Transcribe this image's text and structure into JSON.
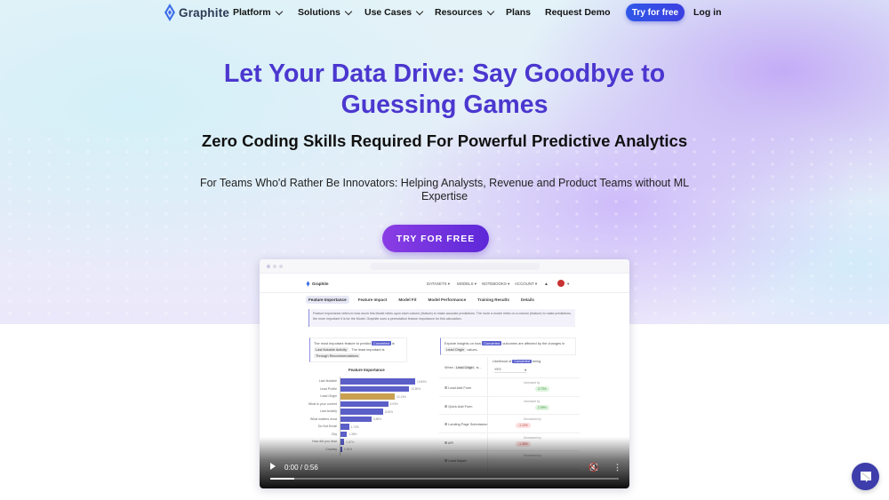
{
  "nav": {
    "brand": "Graphite",
    "items": [
      {
        "label": "Platform",
        "has_dropdown": true
      },
      {
        "label": "Solutions",
        "has_dropdown": true
      },
      {
        "label": "Use Cases",
        "has_dropdown": true
      },
      {
        "label": "Resources",
        "has_dropdown": true
      },
      {
        "label": "Plans",
        "has_dropdown": false
      },
      {
        "label": "Request Demo",
        "has_dropdown": false
      }
    ],
    "try_label": "Try for free",
    "login_label": "Log in"
  },
  "hero": {
    "title_line1": "Let Your Data Drive: Say Goodbye to",
    "title_line2": "Guessing Games",
    "subtitle": "Zero Coding Skills Required For Powerful Predictive Analytics",
    "tagline": "For Teams Who'd Rather Be Innovators:  Helping Analysts, Revenue and Product Teams without ML Expertise",
    "cta_label": "TRY FOR FREE"
  },
  "colors": {
    "accent": "#4b37cf",
    "cta_start": "#8a3de4",
    "cta_end": "#5d28d8",
    "nav_button": "#2f58e8",
    "chat": "#3d3dab"
  },
  "video": {
    "app": {
      "brand": "Graphite",
      "menu": [
        "DATASETS ▾",
        "MODELS ▾",
        "NOTEBOOKS ▾",
        "ACCOUNT ▾"
      ],
      "tabs": [
        "Feature Importance",
        "Feature Impact",
        "Model Fit",
        "Model Performance",
        "Training Results",
        "Details"
      ],
      "active_tab": "Feature Importance",
      "info_text": "Feature Importance refers to how much this Model relies upon each column (feature) to make accurate predictions. The more a model relies on a column (feature) to make predictions, the more important it is for the Model. Graphite uses a permutation feature importance for this calculation.",
      "left_card": {
        "pre": "The most important feature to predict",
        "target": "Converted",
        "mid": "is",
        "feature": "Last Notable Activity",
        "post": ". The least important is",
        "least": "Through Recommendations",
        "end": "."
      },
      "chart_title": "Feature Importance",
      "features": [
        {
          "label": "Last Notable",
          "value": "13.89%",
          "pct": 13.89
        },
        {
          "label": "Lead Profile",
          "value": "12.80%",
          "pct": 12.8
        },
        {
          "label": "Lead Origin",
          "value": "10.13%",
          "pct": 10.13,
          "highlight": true
        },
        {
          "label": "What is your current",
          "value": "8.93%",
          "pct": 8.93
        },
        {
          "label": "Last Activity",
          "value": "8.00%",
          "pct": 8.0
        },
        {
          "label": "What matters most",
          "value": "5.88%",
          "pct": 5.88
        },
        {
          "label": "Do Not Email",
          "value": "1.74%",
          "pct": 1.74
        },
        {
          "label": "City",
          "value": "1.38%",
          "pct": 1.38
        },
        {
          "label": "How did you hear",
          "value": "0.87%",
          "pct": 0.87
        },
        {
          "label": "Country",
          "value": "0.50%",
          "pct": 0.5
        }
      ],
      "right_card": {
        "pre": "Explore insights on how",
        "target": "Converted",
        "mid": "outcomes are affected by the changes in",
        "feature": "Lead Origin",
        "post": "values."
      },
      "insights": {
        "when_label": "When",
        "when_value": "Lead Origin",
        "when_suffix": "is...",
        "likelihood_label": "Likelihood of",
        "likelihood_target": "Converted",
        "likelihood_suffix": "being",
        "select_value": "YES",
        "rows": [
          {
            "label": "Lead Add Form",
            "caption": "Increased by",
            "value": "3.73%",
            "dir": "up"
          },
          {
            "label": "Quick Add Form",
            "caption": "Increased by",
            "value": "2.09%",
            "dir": "up"
          },
          {
            "label": "Landing Page Submission",
            "caption": "Decreased by",
            "value": "-1.10%",
            "dir": "down"
          },
          {
            "label": "API",
            "caption": "Decreased by",
            "value": "-1.38%",
            "dir": "down"
          },
          {
            "label": "Lead Import",
            "caption": "Decreased by",
            "value": "",
            "dir": "down"
          }
        ]
      }
    },
    "player": {
      "time": "0:00 / 0:56",
      "progress_fraction": 0.07
    }
  }
}
